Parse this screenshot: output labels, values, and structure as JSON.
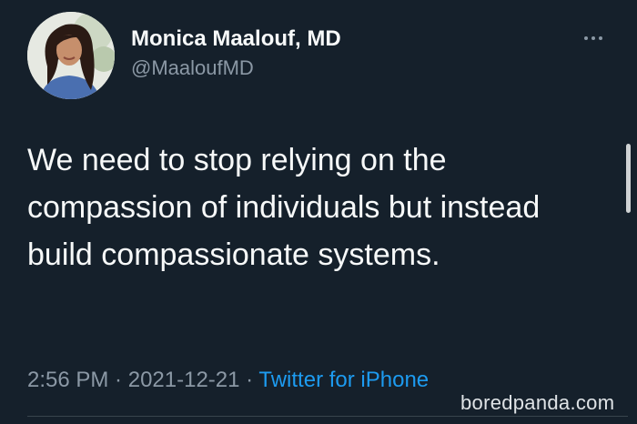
{
  "author": {
    "display_name": "Monica Maalouf, MD",
    "handle": "@MaaloufMD"
  },
  "tweet": {
    "text": "We need to stop relying on the compassion of individuals but instead build compassionate systems.",
    "time": "2:56 PM",
    "separator": " · ",
    "date": "2021-12-21",
    "source": "Twitter for iPhone"
  },
  "menu": {
    "icon": "more-horizontal-icon"
  },
  "watermark": {
    "text": "boredpanda.com"
  },
  "colors": {
    "background": "#15202b",
    "primary_text": "#f7f9f9",
    "secondary_text": "#8b98a5",
    "accent": "#1d9bf0"
  }
}
